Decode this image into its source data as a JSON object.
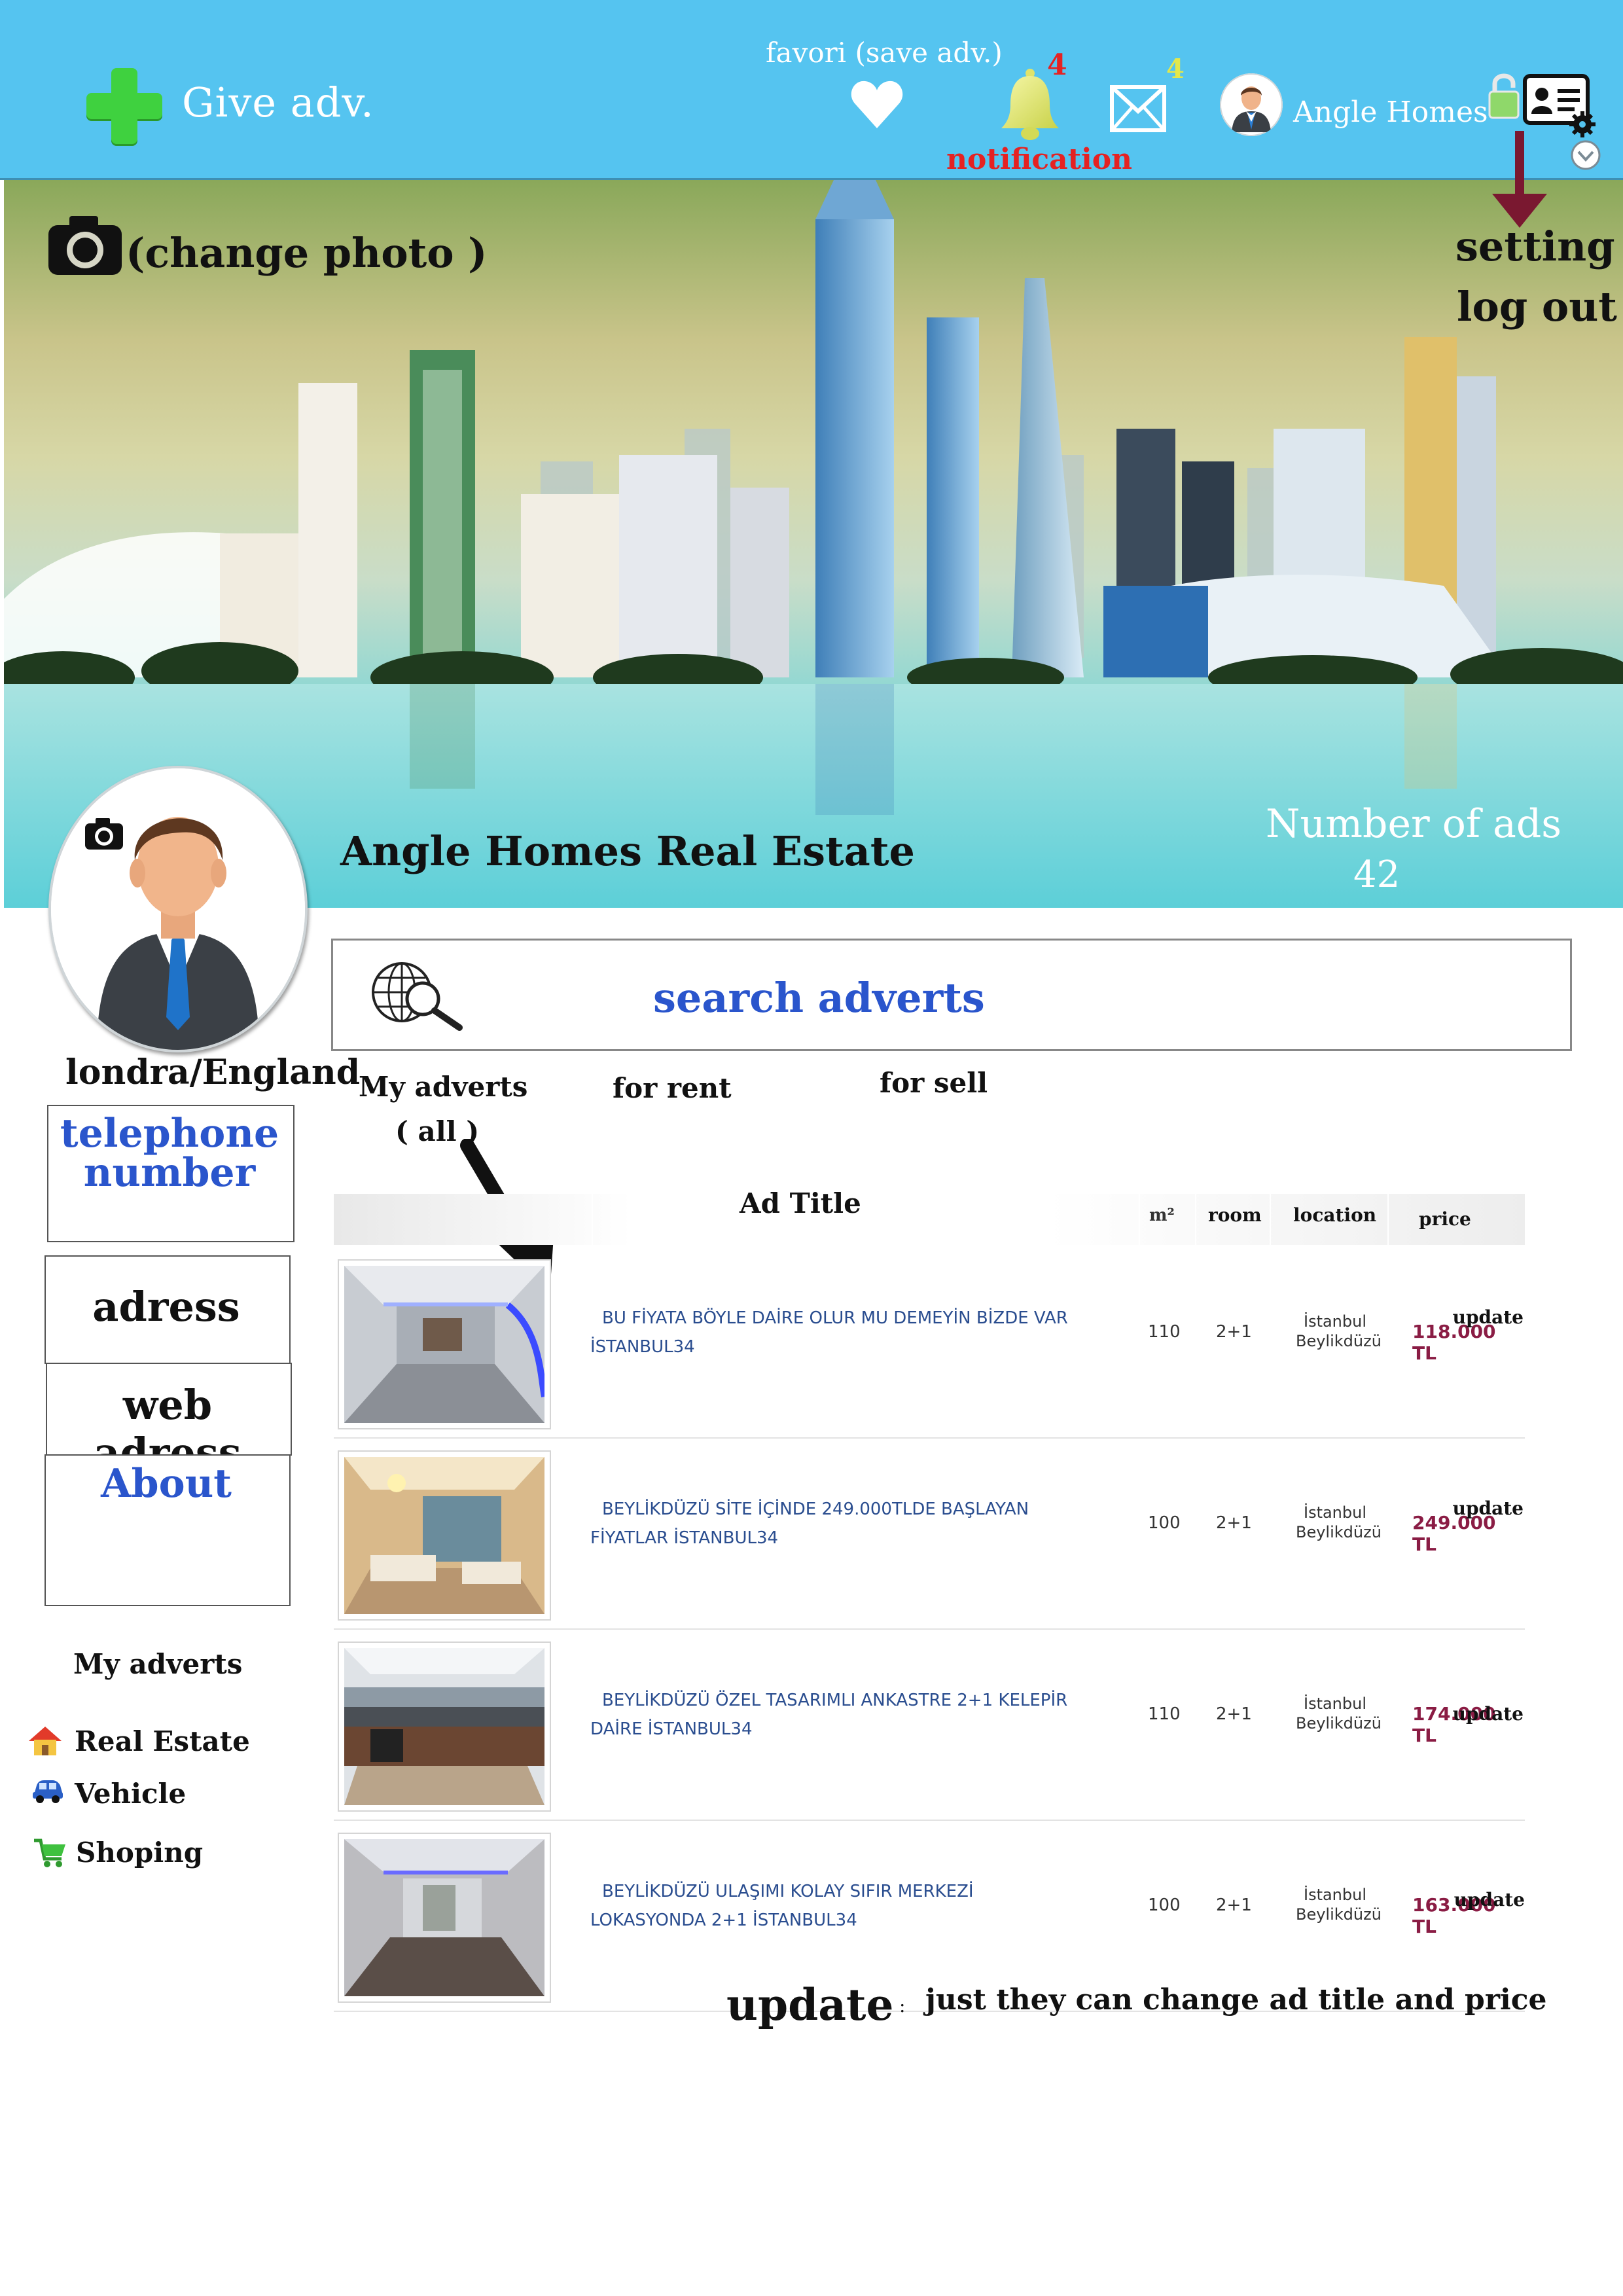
{
  "topbar": {
    "give_adv": "Give adv.",
    "favori_label": "favori (save adv.)",
    "notification_count": "4",
    "notification_label": "notification",
    "message_count": "4",
    "user_name": "Angle Homes",
    "accent_color": "#55c4f0"
  },
  "banner": {
    "change_photo": "(change photo )",
    "setting": "setting",
    "logout": "log out",
    "company_name": "Angle Homes Real Estate",
    "ads_count_label": "Number of ads",
    "ads_count": "42"
  },
  "profile": {
    "location": "londra/England",
    "telephone_line1": "telephone",
    "telephone_line2": "number",
    "address": "adress",
    "web_address": "web adress",
    "about": "About"
  },
  "sidebar": {
    "title": "My adverts",
    "items": [
      {
        "label": "Real Estate",
        "icon": "house-icon"
      },
      {
        "label": "Vehicle",
        "icon": "car-icon"
      },
      {
        "label": "Shoping",
        "icon": "cart-icon"
      }
    ]
  },
  "search": {
    "label": "search adverts"
  },
  "tabs": {
    "my_adverts": "My adverts",
    "all": "( all )",
    "rent": "for rent",
    "sell": "for sell"
  },
  "table": {
    "headers": {
      "title": "Ad Title",
      "m2": "m²",
      "room": "room",
      "location": "location",
      "price": "price"
    },
    "rows": [
      {
        "title_line1": "BU FİYATA BÖYLE DAİRE OLUR MU DEMEYİN BİZDE VAR",
        "title_line2": "İSTANBUL34",
        "m2": "110",
        "room": "2+1",
        "loc_line1": "İstanbul",
        "loc_line2": "Beylikdüzü",
        "price": "118.000 TL",
        "update": "update"
      },
      {
        "title_line1": "BEYLİKDÜZÜ SİTE İÇİNDE 249.000TLDE BAŞLAYAN",
        "title_line2": "FİYATLAR İSTANBUL34",
        "m2": "100",
        "room": "2+1",
        "loc_line1": "İstanbul",
        "loc_line2": "Beylikdüzü",
        "price": "249.000 TL",
        "update": "update"
      },
      {
        "title_line1": "BEYLİKDÜZÜ ÖZEL TASARIMLI ANKASTRE 2+1 KELEPİR",
        "title_line2": "DAİRE İSTANBUL34",
        "m2": "110",
        "room": "2+1",
        "loc_line1": "İstanbul",
        "loc_line2": "Beylikdüzü",
        "price": "174.000 TL",
        "update": "update"
      },
      {
        "title_line1": "BEYLİKDÜZÜ ULAŞIMI KOLAY SIFIR MERKEZİ",
        "title_line2": "LOKASYONDA 2+1 İSTANBUL34",
        "m2": "100",
        "room": "2+1",
        "loc_line1": "İstanbul",
        "loc_line2": "Beylikdüzü",
        "price": "163.000 TL",
        "update": "update"
      }
    ]
  },
  "note": {
    "label": "update",
    "colon": ":",
    "text": "just they can change ad title and price"
  }
}
